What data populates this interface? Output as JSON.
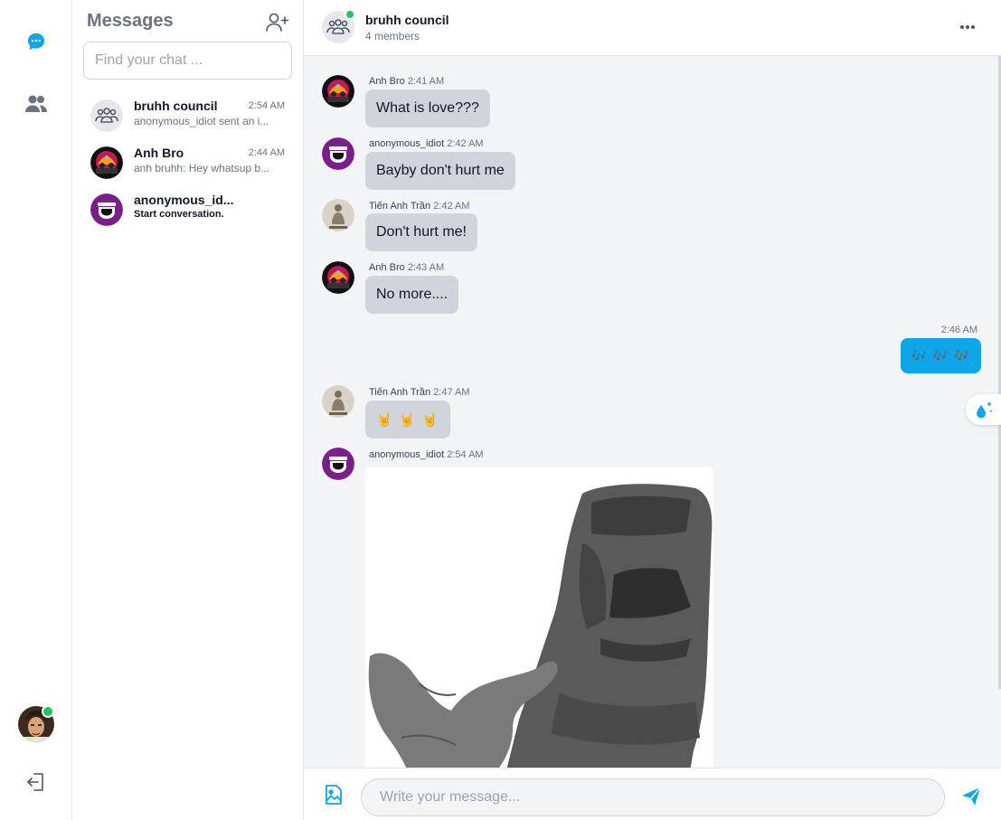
{
  "colors": {
    "accent": "#0ea5e9",
    "online": "#22c55e",
    "bubble_other": "#d1d5db",
    "feed_bg": "#f3f4f6"
  },
  "rail": {
    "icons": [
      "chat-icon",
      "friends-icon",
      "logout-icon"
    ]
  },
  "sidebar": {
    "title": "Messages",
    "search_placeholder": "Find your chat ...",
    "chats": [
      {
        "name": "bruhh council",
        "time": "2:54 AM",
        "preview": "anonymous_idiot sent an i..."
      },
      {
        "name": "Anh Bro",
        "time": "2:44 AM",
        "preview": "anh bruhh: Hey whatsup b..."
      },
      {
        "name": "anonymous_id...",
        "time": "",
        "preview": "Start conversation."
      }
    ]
  },
  "header": {
    "name": "bruhh council",
    "members": "4 members"
  },
  "messages": [
    {
      "sender": "Anh Bro",
      "time": "2:41 AM",
      "text": "What is love???"
    },
    {
      "sender": "anonymous_idiot",
      "time": "2:42 AM",
      "text": "Bayby don't hurt me"
    },
    {
      "sender": "Tiến Anh Trần",
      "time": "2:42 AM",
      "text": "Don't hurt me!"
    },
    {
      "sender": "Anh Bro",
      "time": "2:43 AM",
      "text": "No more...."
    },
    {
      "sender": "",
      "time": "2:46 AM",
      "text": "🎶 🎶 🎶"
    },
    {
      "sender": "Tiến Anh Trần",
      "time": "2:47 AM",
      "text": "🤘 🤘 🤘"
    },
    {
      "sender": "anonymous_idiot",
      "time": "2:54 AM",
      "text": ""
    }
  ],
  "composer": {
    "placeholder": "Write your message..."
  }
}
